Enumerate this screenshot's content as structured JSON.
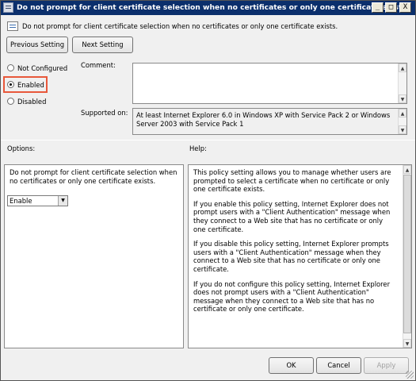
{
  "window": {
    "title": "Do not prompt for client certificate selection when no certificates or only one certificate exists.",
    "controls": {
      "minimize": "_",
      "maximize": "□",
      "close": "X"
    }
  },
  "header": {
    "policy_name": "Do not prompt for client certificate selection when no certificates or only one certificate exists."
  },
  "nav": {
    "previous_label": "Previous Setting",
    "next_label": "Next Setting"
  },
  "state": {
    "options": [
      {
        "label": "Not Configured",
        "selected": false
      },
      {
        "label": "Enabled",
        "selected": true
      },
      {
        "label": "Disabled",
        "selected": false
      }
    ]
  },
  "comment": {
    "label": "Comment:",
    "value": ""
  },
  "supported": {
    "label": "Supported on:",
    "value": "At least Internet Explorer 6.0 in Windows XP with Service Pack 2 or Windows Server 2003 with Service Pack 1"
  },
  "options_pane": {
    "heading": "Options:",
    "description": "Do not prompt for client certificate selection when no certificates or only one certificate exists.",
    "select_value": "Enable"
  },
  "help_pane": {
    "heading": "Help:",
    "paragraphs": [
      "This policy setting allows you to manage whether users are prompted to select a certificate when no certificate or only one certificate exists.",
      "If you enable this policy setting, Internet Explorer does not prompt users with a \"Client Authentication\" message when they connect to a Web site that has no certificate or only one certificate.",
      "If you disable this policy setting, Internet Explorer prompts users with a \"Client Authentication\" message when they connect to a Web site that has no certificate or only one certificate.",
      "If you do not configure this policy setting, Internet Explorer does not prompt users with a \"Client Authentication\" message when they connect to a Web site that has no certificate or only one certificate."
    ]
  },
  "footer": {
    "ok_label": "OK",
    "cancel_label": "Cancel",
    "apply_label": "Apply"
  },
  "colors": {
    "title_bar": "#0b2f6c",
    "highlight": "#e8583b"
  }
}
